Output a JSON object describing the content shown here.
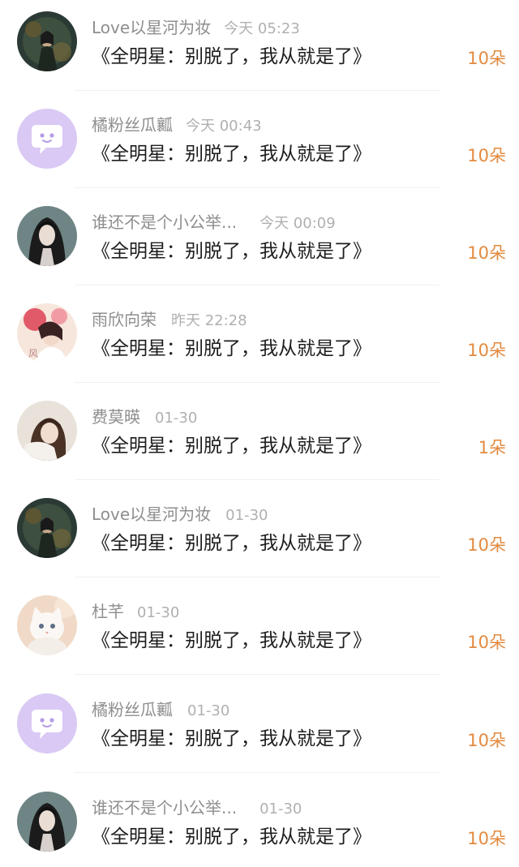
{
  "colors": {
    "accent": "#e38a3f",
    "name_text": "#8e8e8e",
    "time_text": "#b0b0b0",
    "title_text": "#1d1d1d",
    "placeholder_avatar_bg": "#d9c9f4"
  },
  "items": [
    {
      "avatar": "dark-fantasy-avatar",
      "name": "Love以星河为妆",
      "time": "今天 05:23",
      "title": "《全明星：别脱了，我从就是了》",
      "count": "10朵"
    },
    {
      "avatar": "default-chat-avatar",
      "name": "橘粉丝瓜瓤",
      "time": "今天 00:43",
      "title": "《全明星：别脱了，我从就是了》",
      "count": "10朵"
    },
    {
      "avatar": "dark-hair-girl-avatar",
      "name": "谁还不是个小公举...",
      "time": "今天 00:09",
      "title": "《全明星：别脱了，我从就是了》",
      "count": "10朵"
    },
    {
      "avatar": "pink-flower-avatar",
      "name": "雨欣向荣",
      "time": "昨天 22:28",
      "title": "《全明星：别脱了，我从就是了》",
      "count": "10朵"
    },
    {
      "avatar": "girl-photo-avatar",
      "name": "费莫暎",
      "time": "01-30",
      "title": "《全明星：别脱了，我从就是了》",
      "count": "1朵"
    },
    {
      "avatar": "dark-fantasy-avatar",
      "name": "Love以星河为妆",
      "time": "01-30",
      "title": "《全明星：别脱了，我从就是了》",
      "count": "10朵"
    },
    {
      "avatar": "white-cat-avatar",
      "name": "杜芊",
      "time": "01-30",
      "title": "《全明星：别脱了，我从就是了》",
      "count": "10朵"
    },
    {
      "avatar": "default-chat-avatar",
      "name": "橘粉丝瓜瓤",
      "time": "01-30",
      "title": "《全明星：别脱了，我从就是了》",
      "count": "10朵"
    },
    {
      "avatar": "dark-hair-girl-avatar",
      "name": "谁还不是个小公举...",
      "time": "01-30",
      "title": "《全明星：别脱了，我从就是了》",
      "count": "10朵"
    }
  ]
}
